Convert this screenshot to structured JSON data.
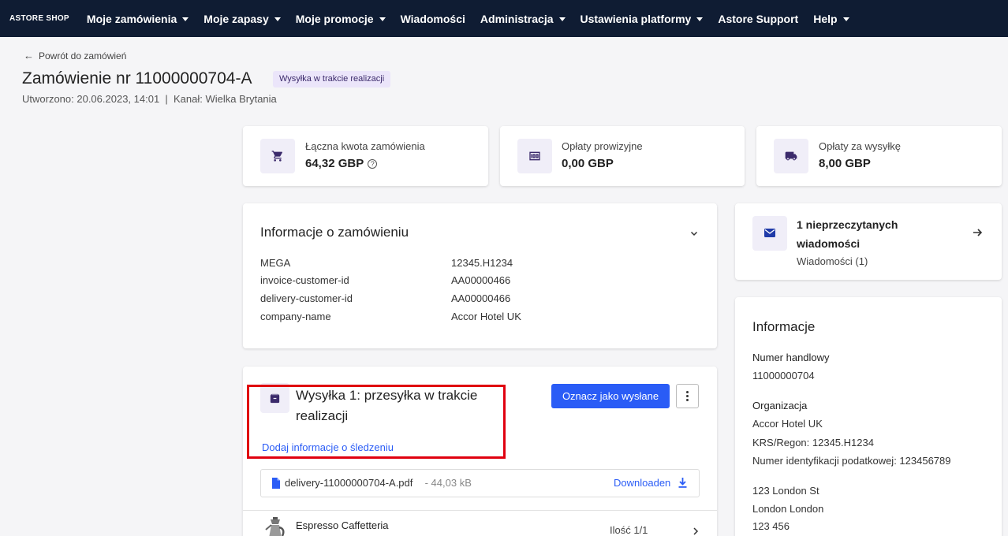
{
  "nav": {
    "logo": "ASTORE SHOP",
    "items": [
      {
        "label": "Moje zamówienia",
        "dropdown": true
      },
      {
        "label": "Moje zapasy",
        "dropdown": true
      },
      {
        "label": "Moje promocje",
        "dropdown": true
      },
      {
        "label": "Wiadomości",
        "dropdown": false
      },
      {
        "label": "Administracja",
        "dropdown": true
      },
      {
        "label": "Ustawienia platformy",
        "dropdown": true
      },
      {
        "label": "Astore Support",
        "dropdown": false
      },
      {
        "label": "Help",
        "dropdown": true
      }
    ]
  },
  "header": {
    "back_label": "Powrót do zamówień",
    "title": "Zamówienie nr 11000000704-A",
    "status_badge": "Wysyłka w trakcie realizacji",
    "created": "Utworzono: 20.06.2023, 14:01  |  Kanał: Wielka Brytania"
  },
  "stats": [
    {
      "label": "Łączna kwota zamówienia",
      "value": "64,32 GBP",
      "icon": "cart-icon",
      "help": true
    },
    {
      "label": "Opłaty prowizyjne",
      "value": "0,00 GBP",
      "icon": "money-icon",
      "help": false
    },
    {
      "label": "Opłaty za wysyłkę",
      "value": "8,00 GBP",
      "icon": "truck-icon",
      "help": false
    }
  ],
  "order_info": {
    "title": "Informacje o zamówieniu",
    "rows": [
      {
        "key": "MEGA",
        "value": "12345.H1234"
      },
      {
        "key": "invoice-customer-id",
        "value": "AA00000466"
      },
      {
        "key": "delivery-customer-id",
        "value": "AA00000466"
      },
      {
        "key": "company-name",
        "value": "Accor Hotel UK"
      }
    ]
  },
  "shipment": {
    "title_line1": "Wysyłka 1: przesyłka w trakcie",
    "title_line2": "realizacji",
    "mark_sent_button": "Oznacz jako wysłane",
    "tracking_link": "Dodaj informacje o śledzeniu",
    "file_name": "delivery-11000000704-A.pdf",
    "file_size": " - 44,03 kB",
    "download_label": "Downloaden",
    "product_name": "Espresso Caffetteria",
    "product_qty": "Ilość 1/1"
  },
  "messages": {
    "title_line1": "1 nieprzeczytanych",
    "title_line2": "wiadomości",
    "subtitle": "Wiadomości (1)"
  },
  "info_panel": {
    "title": "Informacje",
    "trade_number_label": "Numer handlowy",
    "trade_number": "11000000704",
    "org_label": "Organizacja",
    "org_name": "Accor Hotel UK",
    "krs": "KRS/Regon: 12345.H1234",
    "tax_id": "Numer identyfikacji podatkowej: 123456789",
    "address_line1": "123 London St",
    "address_line2": "London London",
    "address_line3": "123 456"
  },
  "colors": {
    "nav_bg": "#0f1c33",
    "accent": "#2a5cf6",
    "icon_purple": "#3b2a6b",
    "highlight": "#e0000f"
  }
}
